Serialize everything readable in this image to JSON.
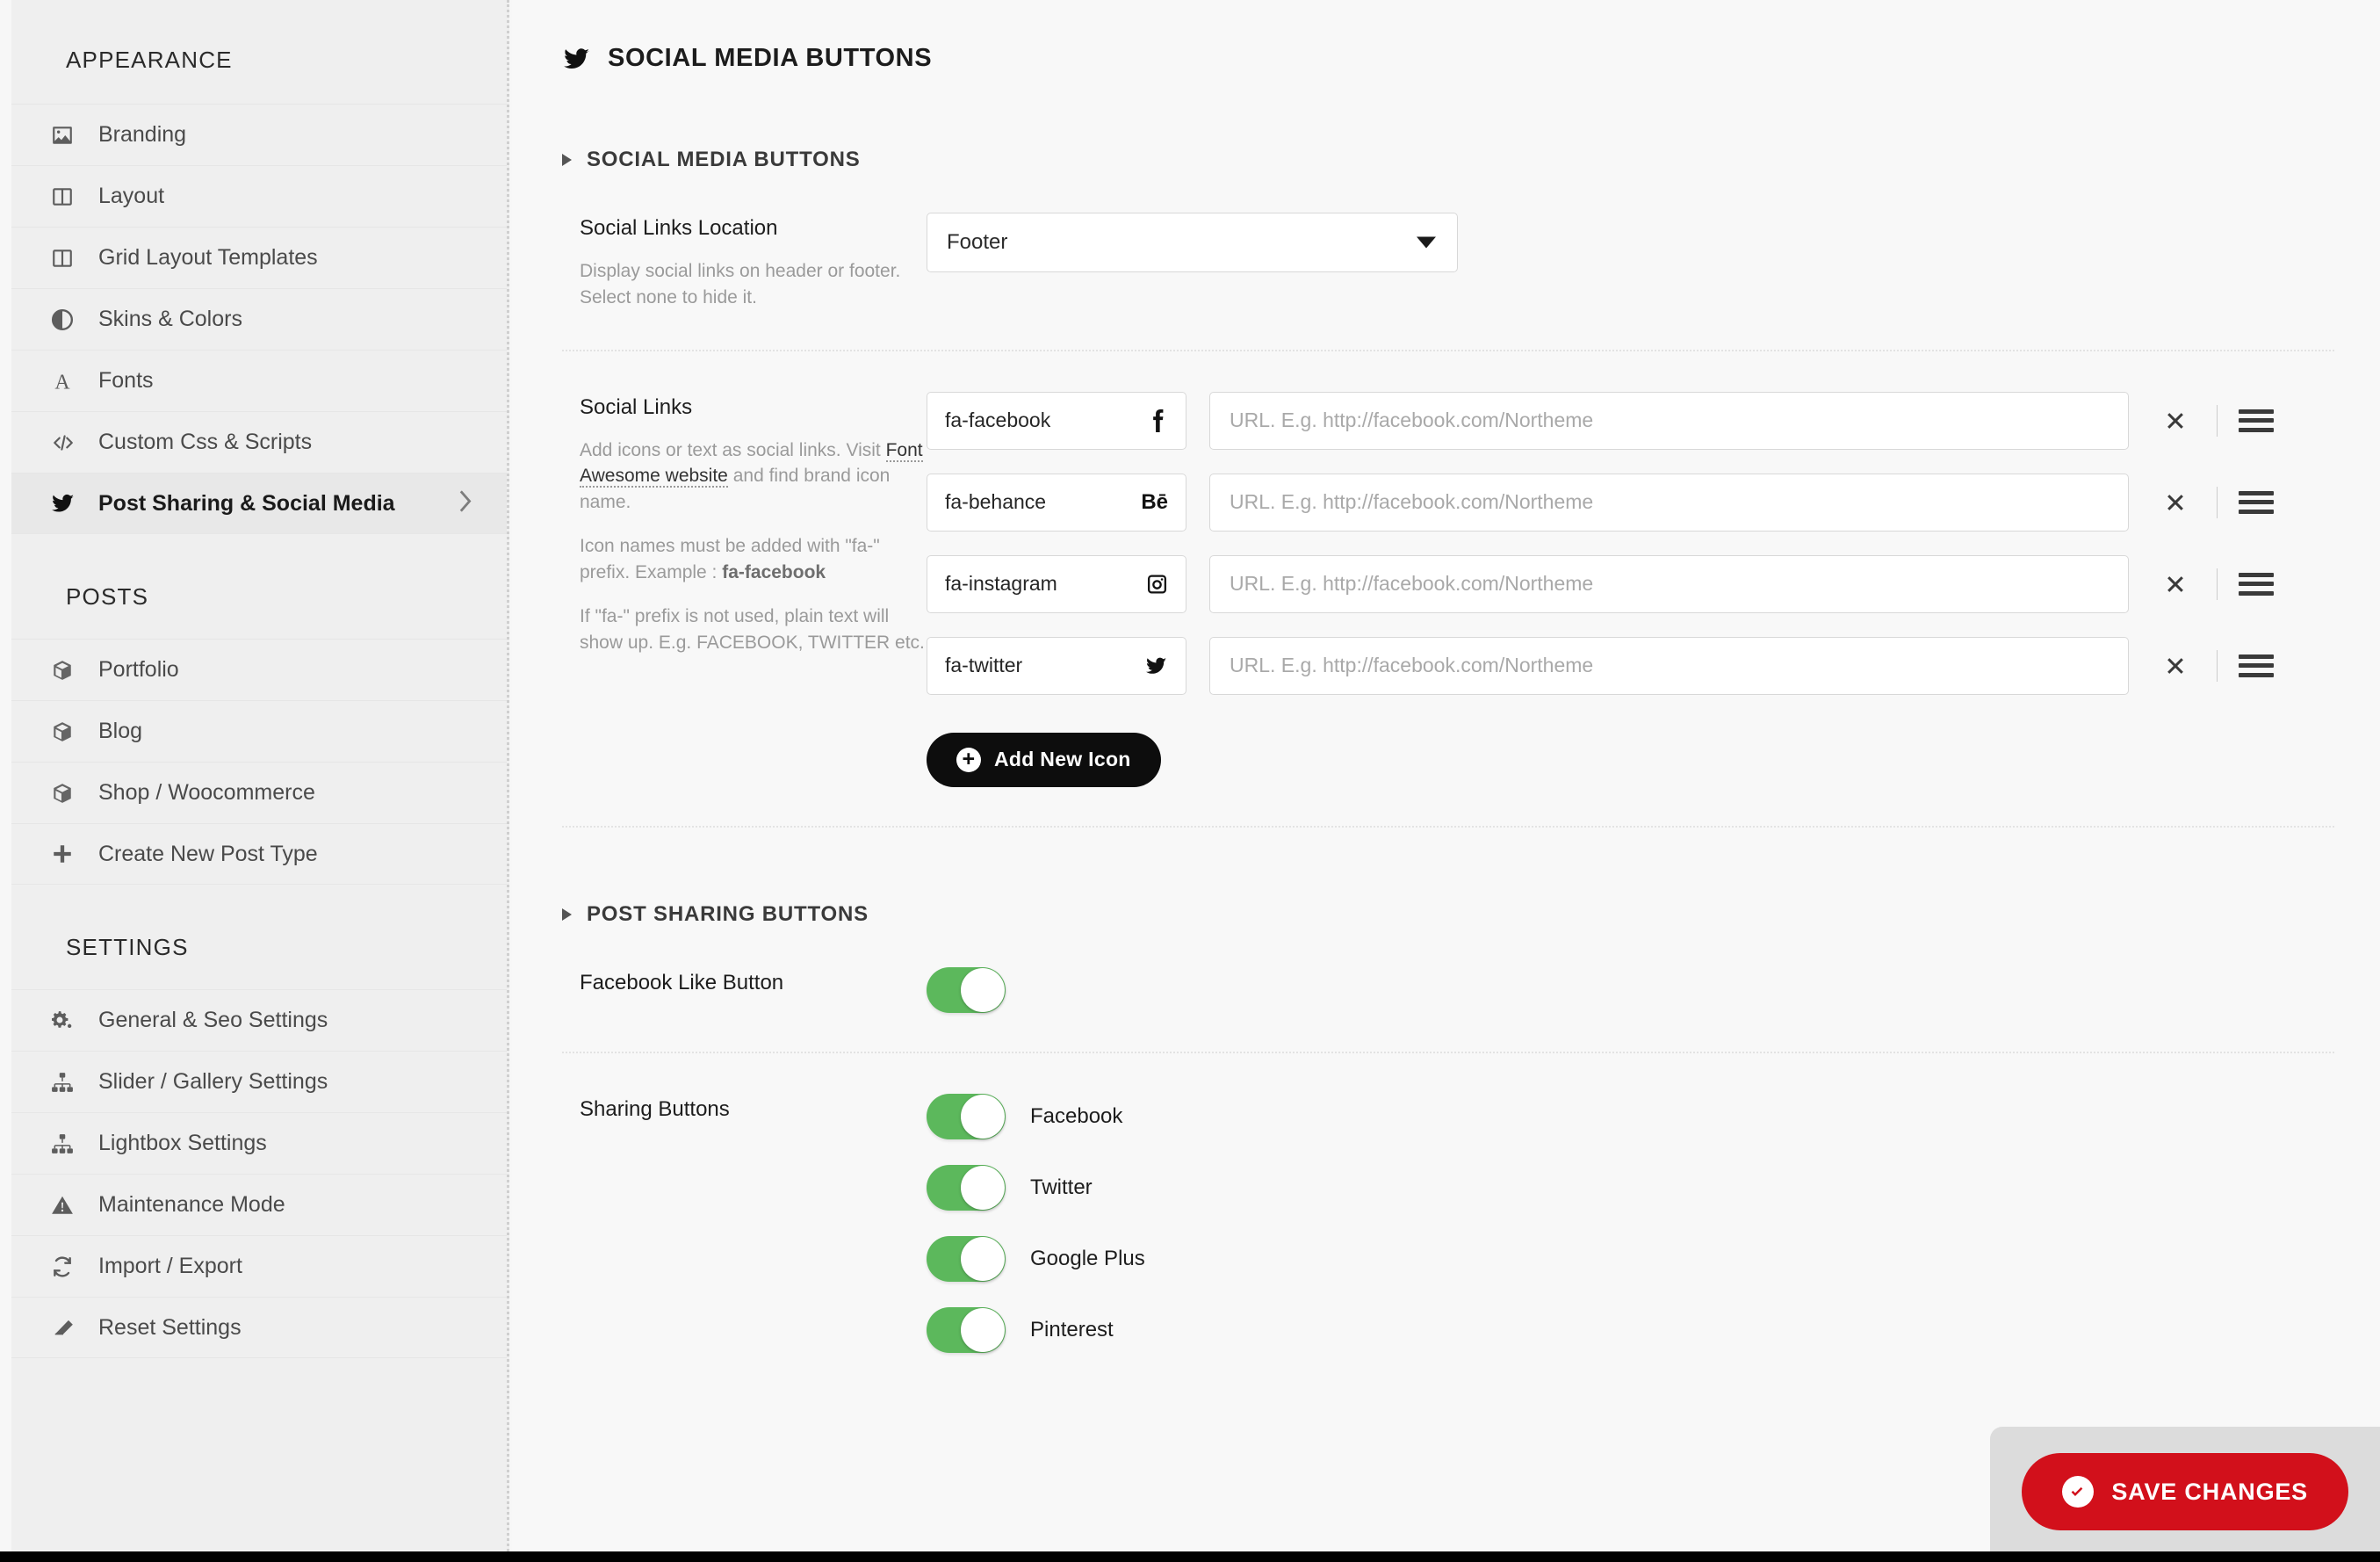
{
  "sidebar": {
    "groups": [
      {
        "title": "APPEARANCE",
        "items": [
          {
            "label": "Branding",
            "icon": "image-icon",
            "active": false
          },
          {
            "label": "Layout",
            "icon": "columns-icon",
            "active": false
          },
          {
            "label": "Grid Layout Templates",
            "icon": "columns-icon",
            "active": false
          },
          {
            "label": "Skins & Colors",
            "icon": "contrast-circle-icon",
            "active": false
          },
          {
            "label": "Fonts",
            "icon": "font-a-icon",
            "active": false
          },
          {
            "label": "Custom Css & Scripts",
            "icon": "code-icon",
            "active": false
          },
          {
            "label": "Post Sharing & Social Media",
            "icon": "twitter-icon",
            "active": true
          }
        ]
      },
      {
        "title": "POSTS",
        "items": [
          {
            "label": "Portfolio",
            "icon": "box-icon",
            "active": false
          },
          {
            "label": "Blog",
            "icon": "box-icon",
            "active": false
          },
          {
            "label": "Shop / Woocommerce",
            "icon": "box-icon",
            "active": false
          },
          {
            "label": "Create New Post Type",
            "icon": "plus-icon",
            "active": false
          }
        ]
      },
      {
        "title": "SETTINGS",
        "items": [
          {
            "label": "General & Seo Settings",
            "icon": "gears-icon",
            "active": false
          },
          {
            "label": "Slider / Gallery Settings",
            "icon": "sitemap-icon",
            "active": false
          },
          {
            "label": "Lightbox Settings",
            "icon": "sitemap-icon",
            "active": false
          },
          {
            "label": "Maintenance Mode",
            "icon": "warning-triangle-icon",
            "active": false
          },
          {
            "label": "Import / Export",
            "icon": "refresh-icon",
            "active": false
          },
          {
            "label": "Reset Settings",
            "icon": "eraser-icon",
            "active": false
          }
        ]
      }
    ]
  },
  "page": {
    "title": "SOCIAL MEDIA BUTTONS",
    "title_icon": "twitter-icon"
  },
  "sections": {
    "social_media_buttons": {
      "heading": "SOCIAL MEDIA BUTTONS",
      "location_row": {
        "label": "Social Links Location",
        "description": "Display social links on header or footer. Select none to hide it.",
        "select_value": "Footer"
      },
      "social_links_row": {
        "label": "Social Links",
        "desc_part1": "Add icons or text as social links. Visit ",
        "desc_link": "Font Awesome website",
        "desc_part2": " and find brand icon name.",
        "desc_p2_pre": "Icon names must be added with \"fa-\" prefix. Example : ",
        "desc_p2_bold": "fa-facebook",
        "desc_p3": "If \"fa-\" prefix is not used, plain text will show up. E.g. FACEBOOK, TWITTER etc.",
        "url_placeholder": "URL. E.g. http://facebook.com/Northeme",
        "links": [
          {
            "icon_name": "fa-facebook",
            "glyph": "facebook-f-icon",
            "url": ""
          },
          {
            "icon_name": "fa-behance",
            "glyph": "behance-icon",
            "url": ""
          },
          {
            "icon_name": "fa-instagram",
            "glyph": "instagram-icon",
            "url": ""
          },
          {
            "icon_name": "fa-twitter",
            "glyph": "twitter-icon",
            "url": ""
          }
        ],
        "add_button_label": "Add New Icon"
      }
    },
    "post_sharing_buttons": {
      "heading": "POST SHARING BUTTONS",
      "facebook_like": {
        "label": "Facebook Like Button",
        "on": true
      },
      "sharing_buttons": {
        "label": "Sharing Buttons",
        "items": [
          {
            "label": "Facebook",
            "on": true
          },
          {
            "label": "Twitter",
            "on": true
          },
          {
            "label": "Google Plus",
            "on": true
          },
          {
            "label": "Pinterest",
            "on": true
          }
        ]
      }
    }
  },
  "save": {
    "label": "SAVE CHANGES",
    "color": "#d2101b",
    "icon": "check-circle-icon"
  },
  "colors": {
    "toggle_on": "#5cb85c",
    "sidebar_bg": "#efefef",
    "main_bg": "#f8f8f8",
    "accent_black": "#0d0d0d"
  }
}
